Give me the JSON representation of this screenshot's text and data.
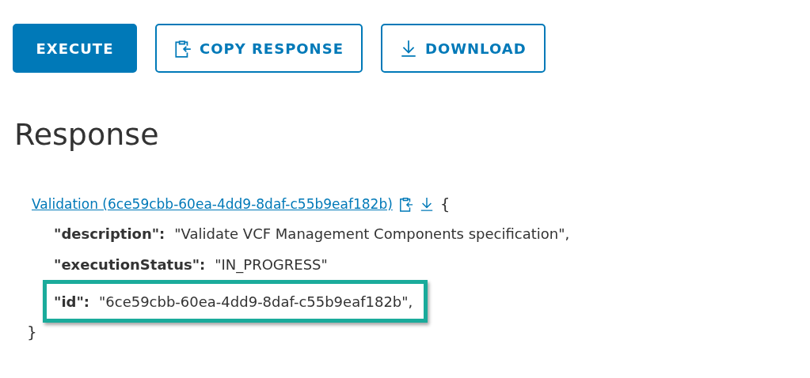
{
  "buttons": [
    {
      "label": "EXECUTE",
      "kind": "primary"
    },
    {
      "label": "COPY RESPONSE",
      "kind": "copy"
    },
    {
      "label": "DOWNLOAD",
      "kind": "download"
    }
  ],
  "heading": "Response",
  "response": {
    "link": "Validation (6ce59cbb-60ea-4dd9-8daf-c55b9eaf182b)",
    "open_brace": "{",
    "close_brace": "}",
    "fields": [
      {
        "key": "\"description\":",
        "value": "\"Validate VCF Management Components specification\",",
        "highlighted": false
      },
      {
        "key": "\"executionStatus\":",
        "value": "\"IN_PROGRESS\"",
        "highlighted": false
      },
      {
        "key": "\"id\":",
        "value": "\"6ce59cbb-60ea-4dd9-8daf-c55b9eaf182b\",",
        "highlighted": true
      }
    ]
  }
}
